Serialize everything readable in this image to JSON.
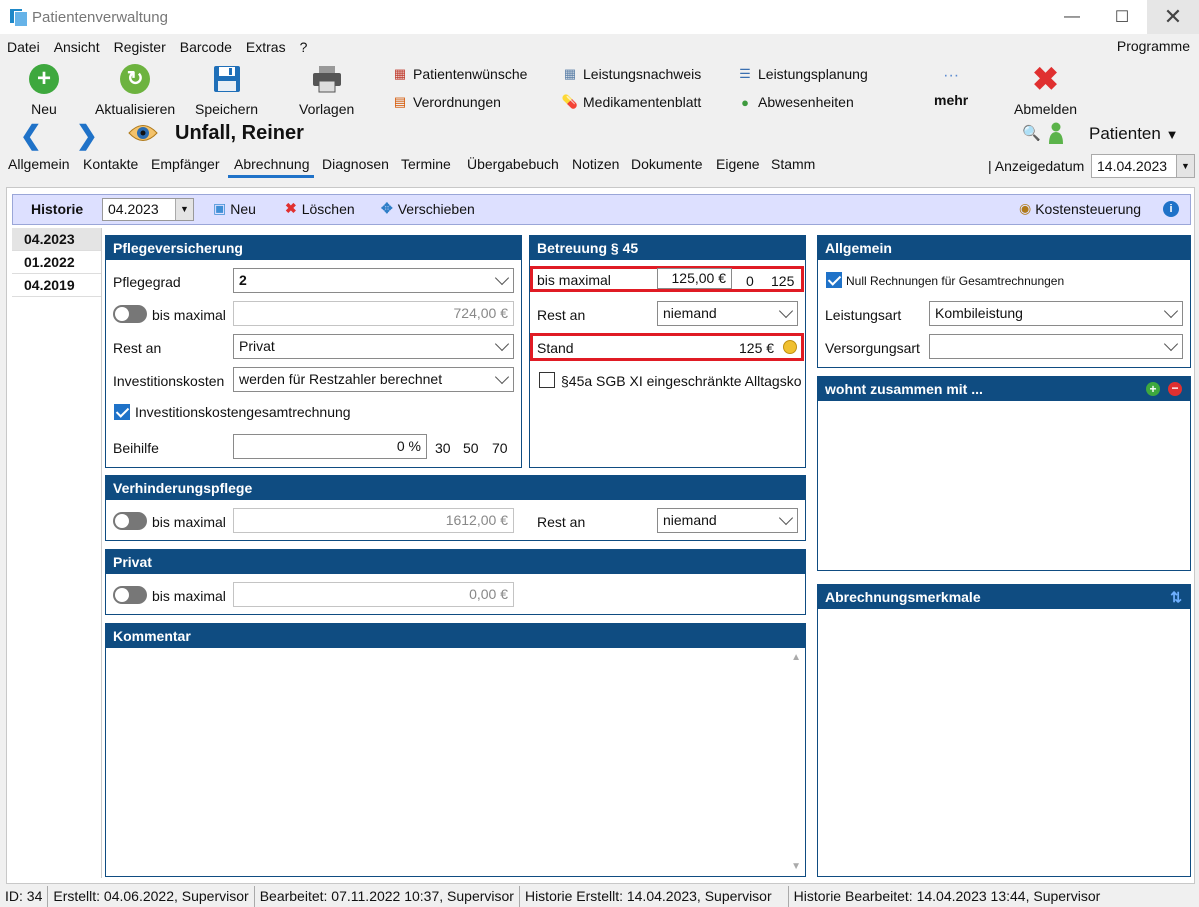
{
  "window": {
    "title": "Patientenverwaltung",
    "min": "—",
    "max": "☐",
    "close": "✕"
  },
  "menu": {
    "items": [
      "Datei",
      "Ansicht",
      "Register",
      "Barcode",
      "Extras",
      "?"
    ],
    "right": "Programme"
  },
  "toolbar": {
    "neu": "Neu",
    "aktualisieren": "Aktualisieren",
    "speichern": "Speichern",
    "vorlagen": "Vorlagen",
    "patientenwuensche": "Patientenwünsche",
    "verordnungen": "Verordnungen",
    "leistungsnachweis": "Leistungsnachweis",
    "medikamentenblatt": "Medikamentenblatt",
    "leistungsplanung": "Leistungsplanung",
    "abwesenheiten": "Abwesenheiten",
    "mehr": "mehr",
    "abmelden": "Abmelden"
  },
  "patient": {
    "name": "Unfall, Reiner",
    "module": "Patienten"
  },
  "tabs": [
    "Allgemein",
    "Kontakte",
    "Empfänger",
    "Abrechnung",
    "Diagnosen",
    "Termine",
    "Übergabebuch",
    "Notizen",
    "Dokumente",
    "Eigene",
    "Stamm"
  ],
  "anzeigedatum": {
    "label": "Anzeigedatum",
    "value": "14.04.2023"
  },
  "historie": {
    "label": "Historie",
    "value": "04.2023",
    "neu": "Neu",
    "loeschen": "Löschen",
    "verschieben": "Verschieben",
    "kostensteuerung": "Kostensteuerung",
    "entries": [
      "04.2023",
      "01.2022",
      "04.2019"
    ]
  },
  "pflegeversicherung": {
    "title": "Pflegeversicherung",
    "pflegegrad_label": "Pflegegrad",
    "pflegegrad": "2",
    "bis_maximal_label": "bis maximal",
    "bis_maximal": "724,00 €",
    "rest_an_label": "Rest an",
    "rest_an": "Privat",
    "invest_label": "Investitionskosten",
    "invest": "werden für Restzahler berechnet",
    "invest_gesamt": "Investitionskostengesamtrechnung",
    "beihilfe_label": "Beihilfe",
    "beihilfe": "0 %",
    "b30": "30",
    "b50": "50",
    "b70": "70"
  },
  "betreuung": {
    "title": "Betreuung § 45",
    "bis_maximal_label": "bis maximal",
    "bis_maximal": "125,00 €",
    "v0": "0",
    "v125": "125",
    "rest_an_label": "Rest an",
    "rest_an": "niemand",
    "stand_label": "Stand",
    "stand": "125 €",
    "sgb": "§45a SGB XI eingeschränkte Alltagsko"
  },
  "allgemein": {
    "title": "Allgemein",
    "null_rechnungen": "Null Rechnungen für Gesamtrechnungen",
    "leistungsart_label": "Leistungsart",
    "leistungsart": "Kombileistung",
    "versorgungsart_label": "Versorgungsart",
    "versorgungsart": ""
  },
  "wohnt": {
    "title": "wohnt zusammen mit ..."
  },
  "verhinderung": {
    "title": "Verhinderungspflege",
    "bis_maximal_label": "bis maximal",
    "bis_maximal": "1612,00 €",
    "rest_an_label": "Rest an",
    "rest_an": "niemand"
  },
  "privat": {
    "title": "Privat",
    "bis_maximal_label": "bis maximal",
    "bis_maximal": "0,00 €"
  },
  "kommentar": {
    "title": "Kommentar"
  },
  "abrechnungsmerkmale": {
    "title": "Abrechnungsmerkmale"
  },
  "status": {
    "id": "ID: 34",
    "erstellt": "Erstellt: 04.06.2022, Supervisor",
    "bearbeitet": "Bearbeitet: 07.11.2022 10:37, Supervisor",
    "hist_erstellt": "Historie Erstellt: 14.04.2023, Supervisor",
    "hist_bearbeitet": "Historie Bearbeitet: 14.04.2023 13:44, Supervisor"
  },
  "colors": {
    "panel_header": "#0f4c81",
    "accent": "#1f72c8",
    "highlight": "#e01b24",
    "historie_bar": "#dde0ff"
  }
}
